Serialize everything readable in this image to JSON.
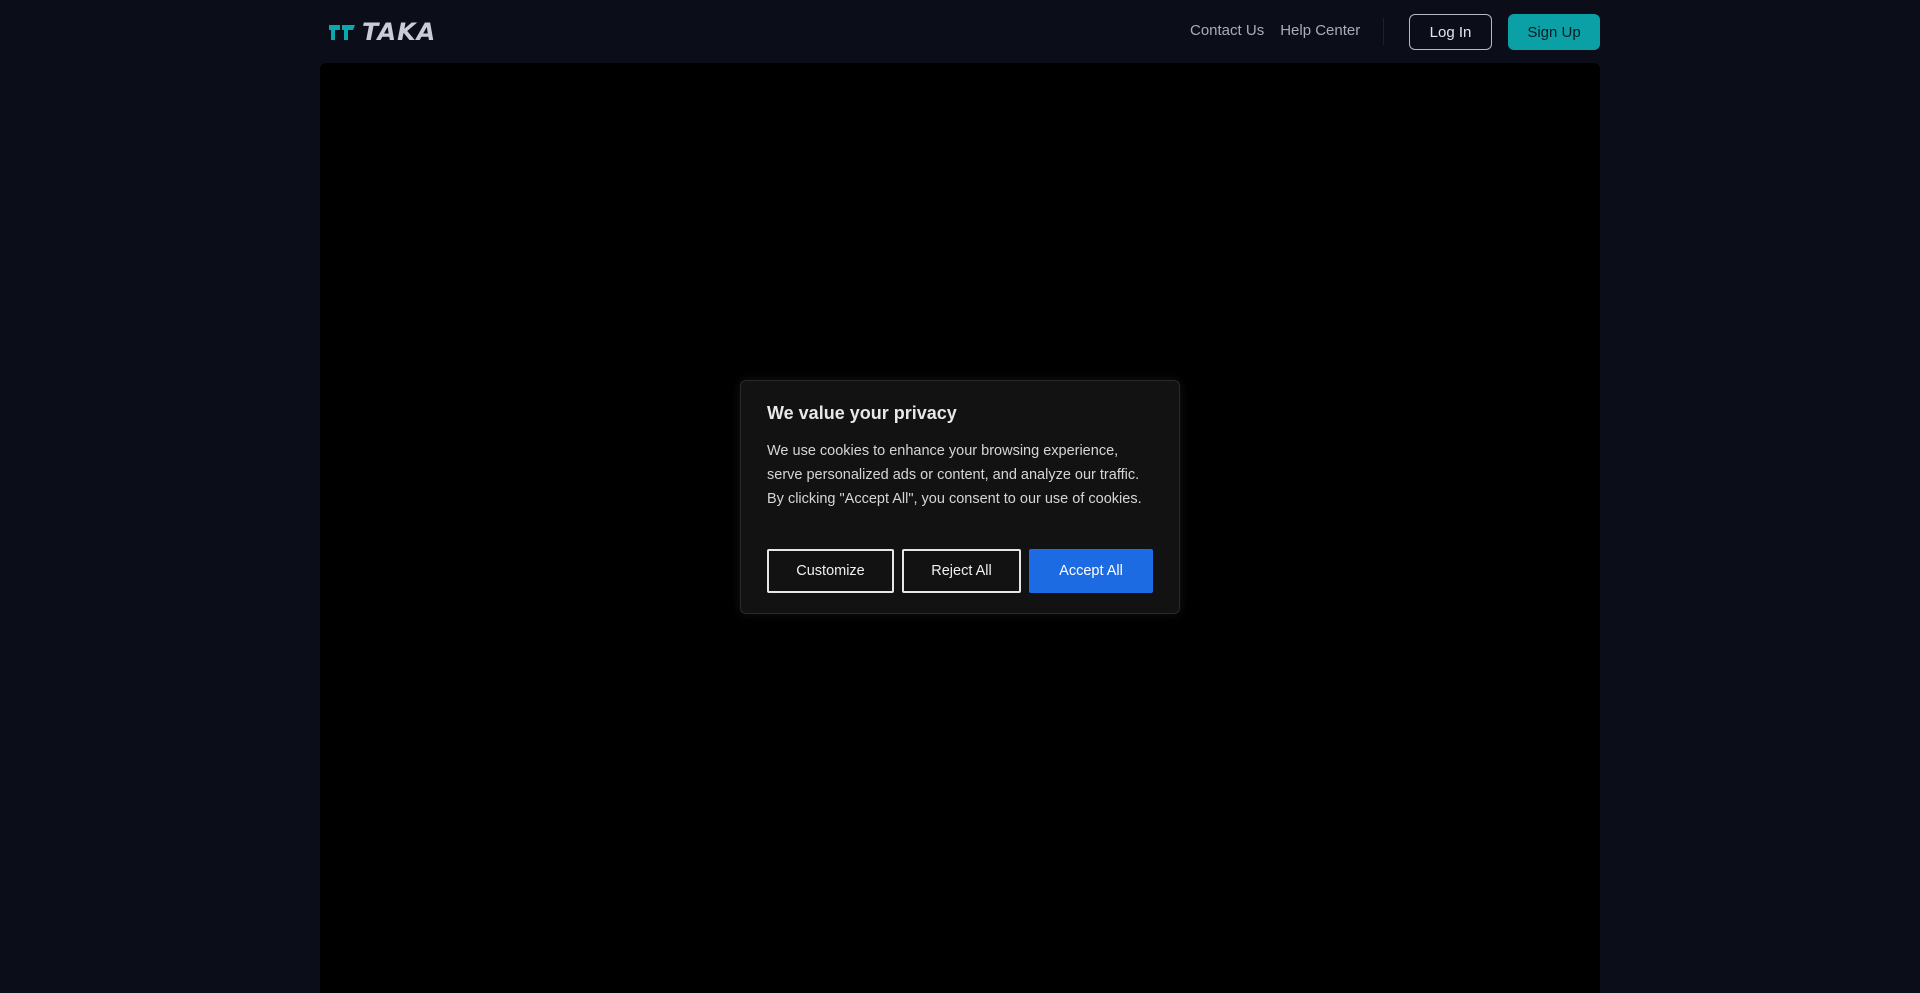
{
  "header": {
    "brand_name": "TAKA",
    "nav_links": [
      "Contact Us",
      "Help Center"
    ],
    "login_label": "Log In",
    "signup_label": "Sign Up"
  },
  "cookie_banner": {
    "title": "We value your privacy",
    "body": "We use cookies to enhance your browsing experience, serve personalized ads or content, and analyze our traffic. By clicking \"Accept All\", you consent to our use of cookies.",
    "customize_label": "Customize",
    "reject_label": "Reject All",
    "accept_label": "Accept All"
  },
  "colors": {
    "page_background": "#0b0d19",
    "stage_background": "#000000",
    "accent_teal": "#0aa0a6",
    "accept_blue": "#1c6be3",
    "dialog_background": "#121212"
  },
  "icons": {
    "logo": "taka-logo-icon"
  }
}
